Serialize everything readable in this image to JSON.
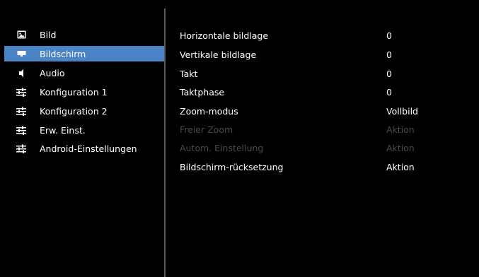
{
  "sidebar": {
    "items": [
      {
        "label": "Bild",
        "icon": "picture-icon"
      },
      {
        "label": "Bildschirm",
        "icon": "screen-icon",
        "selected": true
      },
      {
        "label": "Audio",
        "icon": "speaker-icon"
      },
      {
        "label": "Konfiguration 1",
        "icon": "sliders-icon"
      },
      {
        "label": "Konfiguration 2",
        "icon": "sliders-icon"
      },
      {
        "label": "Erw. Einst.",
        "icon": "sliders-icon"
      },
      {
        "label": "Android-Einstellungen",
        "icon": "sliders-icon"
      }
    ]
  },
  "settings": {
    "rows": [
      {
        "label": "Horizontale bildlage",
        "value": "0",
        "enabled": true
      },
      {
        "label": "Vertikale bildlage",
        "value": "0",
        "enabled": true
      },
      {
        "label": "Takt",
        "value": "0",
        "enabled": true
      },
      {
        "label": "Taktphase",
        "value": "0",
        "enabled": true
      },
      {
        "label": "Zoom-modus",
        "value": "Vollbild",
        "enabled": true
      },
      {
        "label": "Freier Zoom",
        "value": "Aktion",
        "enabled": false
      },
      {
        "label": "Autom. Einstellung",
        "value": "Aktion",
        "enabled": false
      },
      {
        "label": "Bildschirm-rücksetzung",
        "value": "Aktion",
        "enabled": true
      }
    ]
  },
  "colors": {
    "selected_bg": "#4a84c4",
    "disabled_text": "#4a4a4a",
    "divider": "#5a5a5a"
  }
}
